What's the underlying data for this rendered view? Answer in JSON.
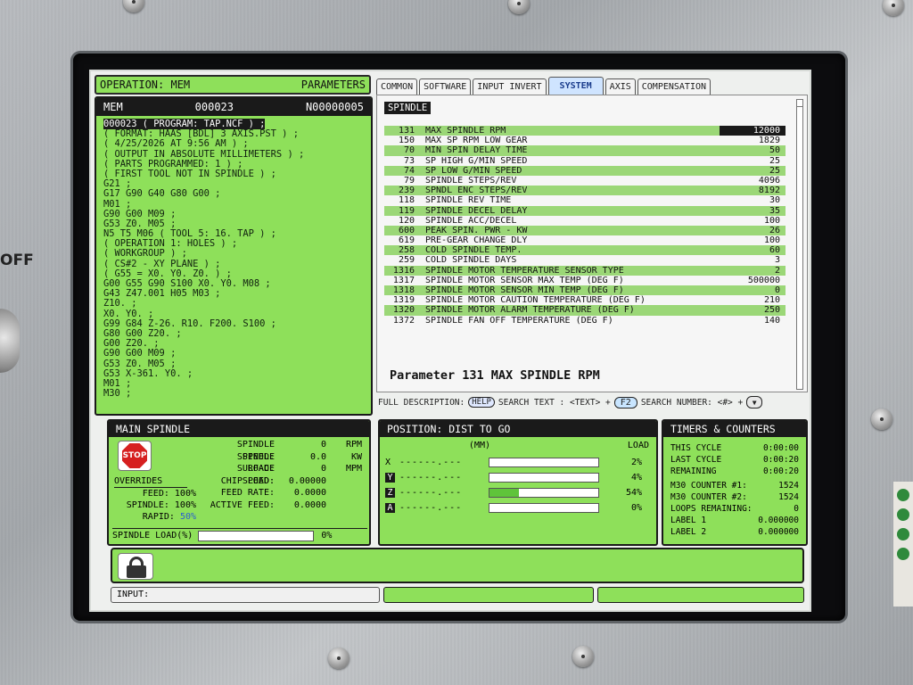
{
  "panel_side_label": "OFF",
  "header": {
    "operation": "OPERATION: MEM",
    "mode": "PARAMETERS"
  },
  "program": {
    "mode": "MEM",
    "number": "000023",
    "block": "N00000005",
    "lines": [
      "000023 ( PROGRAM: TAP.NCF ) ;",
      "( FORMAT: HAAS [BDL] 3 AXIS.PST ) ;",
      "( 4/25/2026 AT 9:56 AM ) ;",
      "( OUTPUT IN ABSOLUTE MILLIMETERS ) ;",
      "( PARTS PROGRAMMED: 1 ) ;",
      "( FIRST TOOL NOT IN SPINDLE ) ;",
      "G21 ;",
      "G17 G90 G40 G80 G00 ;",
      "M01 ;",
      "G90 G00 M09 ;",
      "G53 Z0. M05 ;",
      "N5 T5 M06 ( TOOL 5: 16. TAP ) ;",
      "( OPERATION 1: HOLES ) ;",
      "( WORKGROUP ) ;",
      "( CS#2 - XY PLANE ) ;",
      "( G55 = X0. Y0. Z0. ) ;",
      "G00 G55 G90 S100 X0. Y0. M08 ;",
      "G43 Z47.001 H05 M03 ;",
      "Z10. ;",
      "X0. Y0. ;",
      "G99 G84 Z-26. R10. F200. S100 ;",
      "G80 G00 Z20. ;",
      "G00 Z20. ;",
      "G90 G00 M09 ;",
      "G53 Z0. M05 ;",
      "G53 X-361. Y0. ;",
      "M01 ;",
      "M30 ;"
    ]
  },
  "tabs": [
    {
      "label": "COMMON",
      "active": false
    },
    {
      "label": "SOFTWARE",
      "active": false
    },
    {
      "label": "INPUT INVERT",
      "active": false
    },
    {
      "label": "SYSTEM",
      "active": true
    },
    {
      "label": "AXIS",
      "active": false
    },
    {
      "label": "COMPENSATION",
      "active": false
    }
  ],
  "settings": {
    "category": "SPINDLE",
    "params": [
      {
        "num": "131",
        "name": "MAX SPINDLE RPM",
        "value": "12000"
      },
      {
        "num": "150",
        "name": "MAX SP RPM LOW GEAR",
        "value": "1829"
      },
      {
        "num": "70",
        "name": "MIN SPIN DELAY TIME",
        "value": "50"
      },
      {
        "num": "73",
        "name": "SP HIGH G/MIN SPEED",
        "value": "25"
      },
      {
        "num": "74",
        "name": "SP LOW G/MIN SPEED",
        "value": "25"
      },
      {
        "num": "79",
        "name": "SPINDLE STEPS/REV",
        "value": "4096"
      },
      {
        "num": "239",
        "name": "SPNDL ENC STEPS/REV",
        "value": "8192"
      },
      {
        "num": "118",
        "name": "SPINDLE REV TIME",
        "value": "30"
      },
      {
        "num": "119",
        "name": "SPINDLE DECEL DELAY",
        "value": "35"
      },
      {
        "num": "120",
        "name": "SPINDLE ACC/DECEL",
        "value": "100"
      },
      {
        "num": "600",
        "name": "PEAK SPIN. PWR - KW",
        "value": "26"
      },
      {
        "num": "619",
        "name": "PRE-GEAR CHANGE DLY",
        "value": "100"
      },
      {
        "num": "258",
        "name": "COLD SPINDLE TEMP.",
        "value": "60"
      },
      {
        "num": "259",
        "name": "COLD SPINDLE DAYS",
        "value": "3"
      },
      {
        "num": "1316",
        "name": "SPINDLE MOTOR TEMPERATURE SENSOR TYPE",
        "value": "2"
      },
      {
        "num": "1317",
        "name": "SPINDLE MOTOR SENSOR MAX TEMP (DEG F)",
        "value": "500000"
      },
      {
        "num": "1318",
        "name": "SPINDLE MOTOR SENSOR MIN TEMP (DEG F)",
        "value": "0"
      },
      {
        "num": "1319",
        "name": "SPINDLE MOTOR CAUTION TEMPERATURE (DEG F)",
        "value": "210"
      },
      {
        "num": "1320",
        "name": "SPINDLE MOTOR ALARM TEMPERATURE (DEG F)",
        "value": "250"
      },
      {
        "num": "1372",
        "name": "SPINDLE FAN OFF TEMPERATURE (DEG F)",
        "value": "140"
      }
    ],
    "description": "Parameter 131 MAX SPINDLE RPM"
  },
  "help_bar": {
    "full_desc": "FULL DESCRIPTION:",
    "help_key": "HELP",
    "search_text": "SEARCH TEXT : <TEXT> +",
    "f2_key": "F2",
    "search_number": "SEARCH NUMBER: <#> +"
  },
  "main_spindle": {
    "title": "MAIN SPINDLE",
    "stop_label": "STOP",
    "overrides_title": "OVERRIDES",
    "overrides": [
      {
        "label": "FEED:",
        "value": "100%"
      },
      {
        "label": "SPINDLE:",
        "value": "100%"
      },
      {
        "label": "RAPID:",
        "value": "50%"
      }
    ],
    "stats": [
      {
        "label": "SPINDLE SPEED:",
        "value": "0",
        "unit": "RPM"
      },
      {
        "label": "SPINDLE LOAD:",
        "value": "0.0",
        "unit": "KW"
      },
      {
        "label": "SURFACE SPEED:",
        "value": "0",
        "unit": "MPM"
      },
      {
        "label": "CHIP LOAD:",
        "value": "0.00000",
        "unit": ""
      },
      {
        "label": "FEED RATE:",
        "value": "0.0000",
        "unit": ""
      },
      {
        "label": "ACTIVE FEED:",
        "value": "0.0000",
        "unit": ""
      }
    ],
    "load_label": "SPINDLE LOAD(%)",
    "load_value": "0%",
    "load_fraction": 0
  },
  "position": {
    "title": "POSITION: DIST TO GO",
    "units_header": "(MM)",
    "load_header": "LOAD",
    "axes": [
      {
        "axis": "X",
        "boxed": false,
        "value": "------.---",
        "load_pct": "2%",
        "load_fraction": 0.0
      },
      {
        "axis": "Y",
        "boxed": true,
        "value": "------.---",
        "load_pct": "4%",
        "load_fraction": 0.0
      },
      {
        "axis": "Z",
        "boxed": true,
        "value": "------.---",
        "load_pct": "54%",
        "load_fraction": 0.27
      },
      {
        "axis": "A",
        "boxed": true,
        "value": "------.---",
        "load_pct": "0%",
        "load_fraction": 0.0
      }
    ]
  },
  "timers": {
    "title": "TIMERS & COUNTERS",
    "rows": [
      {
        "label": "THIS CYCLE",
        "value": "0:00:00"
      },
      {
        "label": "LAST CYCLE",
        "value": "0:00:20"
      },
      {
        "label": "REMAINING",
        "value": "0:00:20"
      },
      {
        "label": "M30 COUNTER #1:",
        "value": "1524"
      },
      {
        "label": "M30 COUNTER #2:",
        "value": "1524"
      },
      {
        "label": "LOOPS REMAINING:",
        "value": "0"
      },
      {
        "label": "LABEL 1",
        "value": "0.000000"
      },
      {
        "label": "LABEL 2",
        "value": "0.000000"
      }
    ]
  },
  "input": {
    "label": "INPUT:"
  },
  "colors": {
    "accent_green": "#8ee05a",
    "stripe_green": "#9bd777",
    "panel_dark": "#1a1a1a",
    "stop_red": "#d62020",
    "override_blue": "#2c5fd0"
  }
}
